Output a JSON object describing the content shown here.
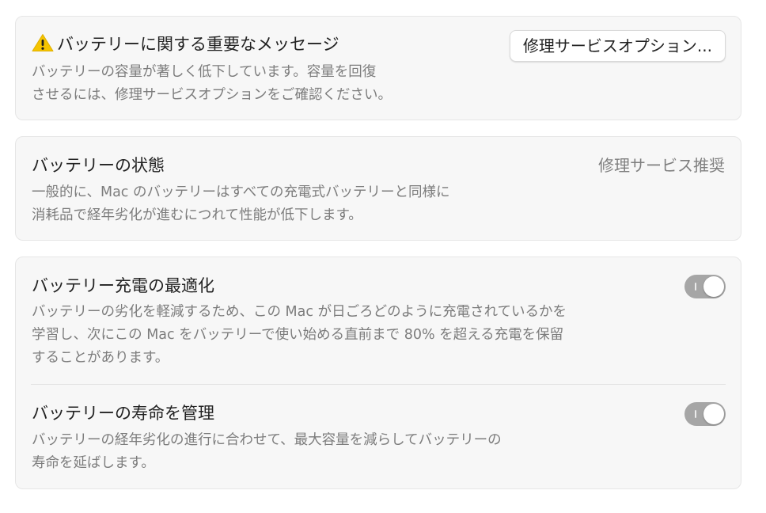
{
  "warning": {
    "title": "バッテリーに関する重要なメッセージ",
    "description_line1": "バッテリーの容量が著しく低下しています。容量を回復",
    "description_line2": "させるには、修理サービスオプションをご確認ください。",
    "button_label": "修理サービスオプション...",
    "icon": "warning-triangle-icon",
    "icon_color": "#f5c400"
  },
  "health": {
    "title": "バッテリーの状態",
    "status": "修理サービス推奨",
    "description_line1": "一般的に、Mac のバッテリーはすべての充電式バッテリーと同様に",
    "description_line2": "消耗品で経年劣化が進むにつれて性能が低下します。"
  },
  "optimized_charging": {
    "title": "バッテリー充電の最適化",
    "description_line1": "バッテリーの劣化を軽減するため、この Mac が日ごろどのように充電されているかを",
    "description_line2": "学習し、次にこの Mac をバッテリーで使い始める直前まで 80% を超える充電を保留",
    "description_line3": "することがあります。",
    "toggle_state": "on"
  },
  "manage_lifespan": {
    "title": "バッテリーの寿命を管理",
    "description_line1": "バッテリーの経年劣化の進行に合わせて、最大容量を減らしてバッテリーの",
    "description_line2": "寿命を延ばします。",
    "toggle_state": "on"
  },
  "colors": {
    "card_background": "#f7f7f7",
    "toggle_track": "#a6a6a6",
    "secondary_text": "#7c7c7c"
  }
}
